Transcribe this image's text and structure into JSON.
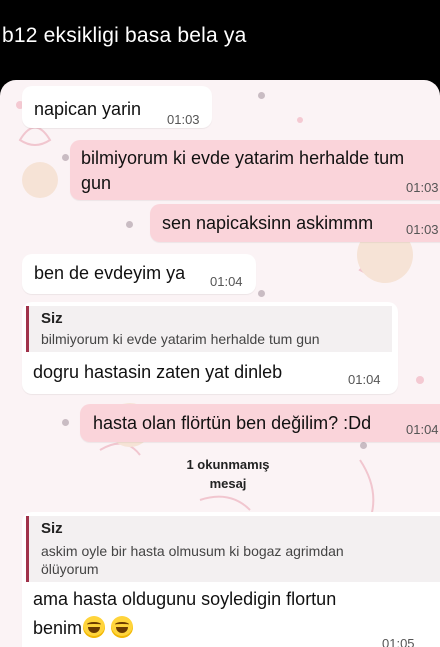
{
  "caption": "b12 eksikligi basa bela ya",
  "messages": {
    "m1": {
      "text": "napican yarin",
      "time": "01:03"
    },
    "m2": {
      "line1": "bilmiyorum ki evde yatarim herhalde tum",
      "line2": "gun",
      "time": "01:03"
    },
    "m3": {
      "text": "sen napicaksinn askimmm",
      "time": "01:03"
    },
    "m4": {
      "text": "ben de evdeyim ya",
      "time": "01:04"
    },
    "m5": {
      "quote_name": "Siz",
      "quote_text": "bilmiyorum ki evde yatarim herhalde tum gun",
      "text": "dogru hastasin zaten yat dinleb",
      "time": "01:04"
    },
    "m6": {
      "text": "hasta olan flörtün ben değilim? :Dd",
      "time": "01:04"
    },
    "unread": {
      "line1": "1 okunmamış",
      "line2": "mesaj"
    },
    "m7": {
      "quote_name": "Siz",
      "quote_line1": "askim oyle bir hasta olmusum ki bogaz agrimdan",
      "quote_line2": "ölüyorum",
      "line1": "ama hasta oldugunu soyledigin flortun",
      "line2": "benim",
      "emojis": [
        "grinning-sweat-emoji",
        "grinning-sweat-emoji"
      ],
      "time": "01:05"
    }
  },
  "colors": {
    "incoming": "#ffffff",
    "outgoing": "#fad4da",
    "quote_bar": "#a0324a",
    "background": "#fbf3f5"
  }
}
